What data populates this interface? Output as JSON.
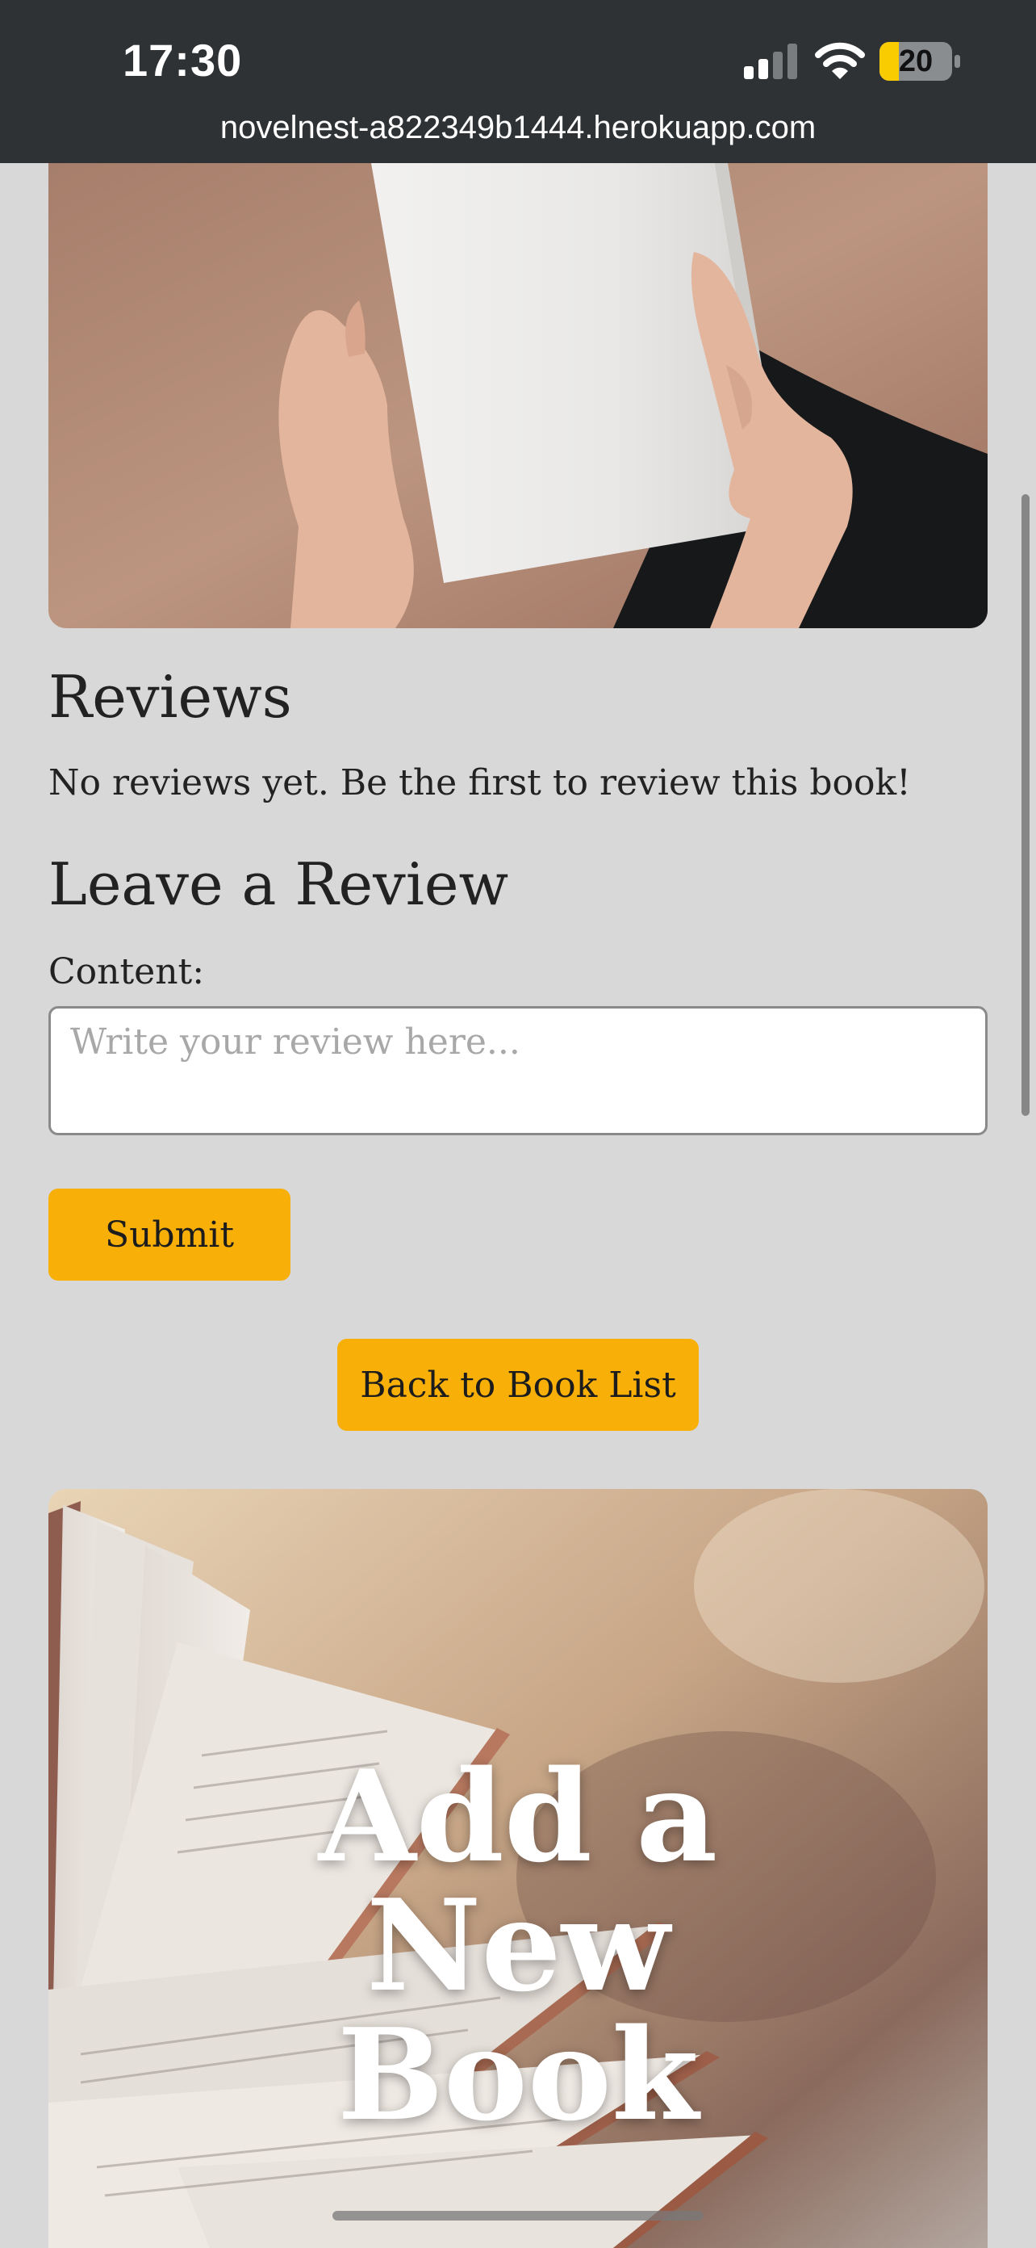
{
  "status_bar": {
    "time": "17:30",
    "battery": "20",
    "url": "novelnest-a822349b1444.herokuapp.com"
  },
  "reviews": {
    "heading": "Reviews",
    "empty_message": "No reviews yet. Be the first to review this book!"
  },
  "review_form": {
    "heading": "Leave a Review",
    "content_label": "Content:",
    "content_placeholder": "Write your review here...",
    "submit_label": "Submit"
  },
  "navigation": {
    "back_label": "Back to Book List"
  },
  "add_book": {
    "title_line1": "Add a",
    "title_line2": "New",
    "title_line3": "Book"
  },
  "colors": {
    "page_background": "#d8d8d8",
    "status_bar": "#2f3235",
    "button": "#f8b008",
    "battery_fill": "#f8cc00"
  },
  "icons": [
    "signal-icon",
    "wifi-icon",
    "battery-icon"
  ]
}
